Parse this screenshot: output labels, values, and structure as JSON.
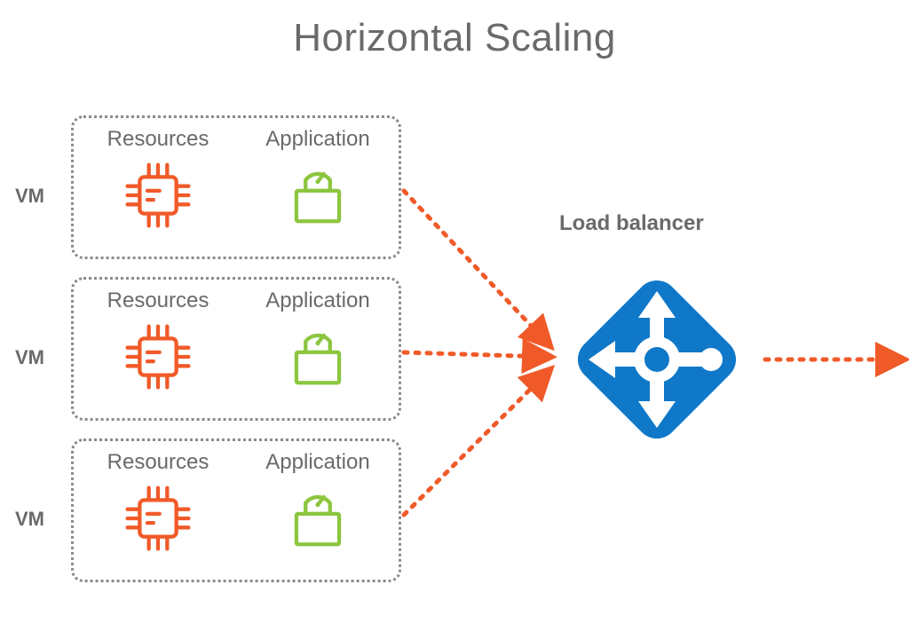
{
  "title": "Horizontal Scaling",
  "colors": {
    "orange": "#f05a28",
    "green": "#8cc63f",
    "blue": "#0f78c8",
    "grey": "#6a6a6a",
    "border": "#8a8a8a"
  },
  "vm_label": "VM",
  "columns": {
    "resources": "Resources",
    "application": "Application"
  },
  "vms": [
    {
      "label_path": "vm_label"
    },
    {
      "label_path": "vm_label"
    },
    {
      "label_path": "vm_label"
    }
  ],
  "load_balancer": {
    "label": "Load balancer"
  },
  "icon_names": {
    "resources": "cpu-chip-icon",
    "application": "package-gauge-icon",
    "load_balancer": "load-balancer-icon"
  }
}
